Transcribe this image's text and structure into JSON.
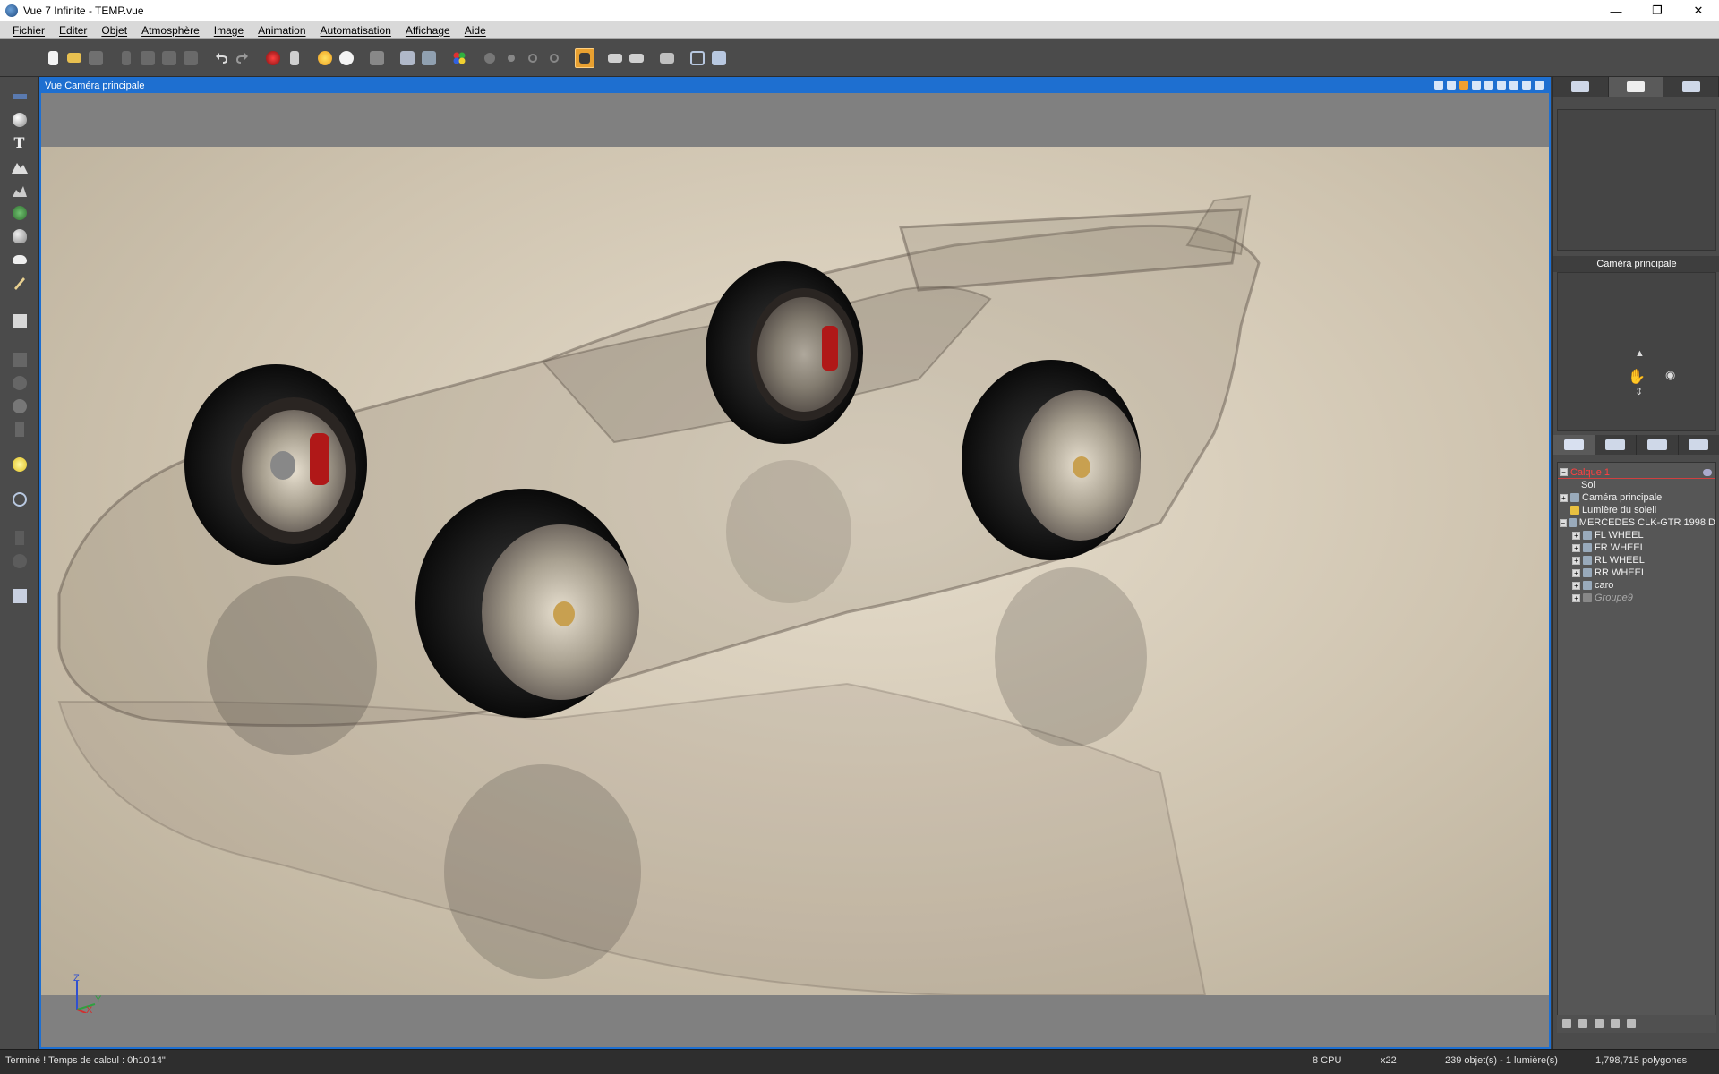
{
  "window": {
    "title": "Vue 7 Infinite - TEMP.vue",
    "controls": [
      "minimize-icon",
      "restore-icon",
      "close-icon"
    ]
  },
  "menu": [
    "Fichier",
    "Editer",
    "Objet",
    "Atmosphère",
    "Image",
    "Animation",
    "Automatisation",
    "Affichage",
    "Aide"
  ],
  "toolbar_icons": [
    "new-file-icon",
    "open-file-icon",
    "save-icon",
    "cut-icon",
    "copy-icon",
    "paste-icon",
    "duplicate-icon",
    "undo-icon",
    "redo-icon",
    "material-icon",
    "link-icon",
    "atmosphere-icon",
    "clouds-icon",
    "cube-icon",
    "brush-icon",
    "ecosystem-icon",
    "color-palette-icon",
    "sphere-gray-icon",
    "dot-icon",
    "zoom-in-icon",
    "zoom-out-icon",
    "render-area-icon",
    "render-icon",
    "render-anim-icon",
    "clapper-icon",
    "grid-icon",
    "camera-icon"
  ],
  "left_tools": [
    "select-icon",
    "sphere-icon",
    "text-icon",
    "terrain-icon",
    "rocks-icon",
    "plant-icon",
    "stone-icon",
    "cloud-icon",
    "pen-icon",
    "cube-icon",
    "boolean-union-icon",
    "boolean-diff-icon",
    "metablob-icon",
    "cylinder-icon",
    "light-icon",
    "transform-icon",
    "stats-icon",
    "sphere-dark-icon",
    "export-icon"
  ],
  "viewport": {
    "title": "Vue Caméra principale",
    "header_icons": [
      "camera-mode-icon",
      "lock-icon",
      "active-orange-icon",
      "dot-icon",
      "zoom-icon",
      "zoom-out-icon",
      "pan-icon",
      "fit-icon",
      "maximize-icon"
    ],
    "axis_labels": {
      "z": "Z",
      "y": "Y",
      "x": "X"
    }
  },
  "right_panel": {
    "top_tabs": [
      "object-tab",
      "scene-tab",
      "camera-tab"
    ],
    "camera_title": "Caméra principale",
    "lower_tabs": [
      "objects-tab",
      "materials-tab",
      "library-tab",
      "links-tab"
    ],
    "tree": [
      {
        "label": "Calque 1",
        "type": "layer",
        "level": 0,
        "expand": "−"
      },
      {
        "label": "Sol",
        "type": "node",
        "level": 1,
        "expand": ""
      },
      {
        "label": "Caméra principale",
        "type": "node",
        "level": 1,
        "expand": "+"
      },
      {
        "label": "Lumière du soleil",
        "type": "node",
        "level": 1,
        "expand": ""
      },
      {
        "label": "MERCEDES CLK-GTR 1998 D",
        "type": "node",
        "level": 1,
        "expand": "−"
      },
      {
        "label": "FL WHEEL",
        "type": "node",
        "level": 2,
        "expand": "+"
      },
      {
        "label": "FR WHEEL",
        "type": "node",
        "level": 2,
        "expand": "+"
      },
      {
        "label": "RL WHEEL",
        "type": "node",
        "level": 2,
        "expand": "+"
      },
      {
        "label": "RR WHEEL",
        "type": "node",
        "level": 2,
        "expand": "+"
      },
      {
        "label": "caro",
        "type": "node",
        "level": 2,
        "expand": "+"
      },
      {
        "label": "Groupe9",
        "type": "italic",
        "level": 2,
        "expand": "+"
      }
    ]
  },
  "status": {
    "message": "Terminé ! Temps de calcul : 0h10'14\"",
    "cpu": "8 CPU",
    "zoom": "x22",
    "objects": "239 objet(s) - 1 lumière(s)",
    "polygons": "1,798,715 polygones"
  },
  "colors": {
    "accent": "#1e6fd0",
    "active_tool": "#e8a030",
    "layer_text": "#ff4040",
    "render_bg": "#d6ccb8"
  }
}
